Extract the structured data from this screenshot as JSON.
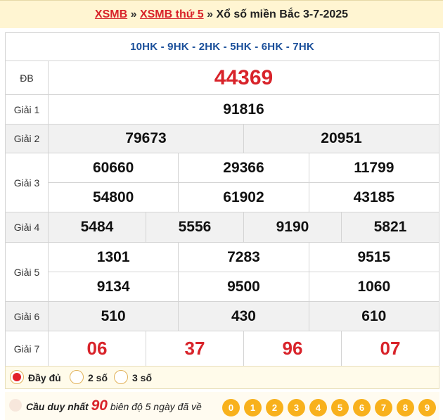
{
  "header": {
    "link1": "XSMB",
    "sep1": " » ",
    "link2": "XSMB thứ 5",
    "sep2": " » ",
    "title": "Xổ số miền Bắc 3-7-2025"
  },
  "codes": "10HK - 9HK - 2HK - 5HK - 6HK - 7HK",
  "prizes": {
    "db": {
      "label": "ĐB",
      "numbers": [
        "44369"
      ]
    },
    "g1": {
      "label": "Giải 1",
      "numbers": [
        "91816"
      ]
    },
    "g2": {
      "label": "Giải 2",
      "numbers": [
        "79673",
        "20951"
      ]
    },
    "g3": {
      "label": "Giải 3",
      "numbers": [
        "60660",
        "29366",
        "11799",
        "54800",
        "61902",
        "43185"
      ]
    },
    "g4": {
      "label": "Giải 4",
      "numbers": [
        "5484",
        "5556",
        "9190",
        "5821"
      ]
    },
    "g5": {
      "label": "Giải 5",
      "numbers": [
        "1301",
        "7283",
        "9515",
        "9134",
        "9500",
        "1060"
      ]
    },
    "g6": {
      "label": "Giải 6",
      "numbers": [
        "510",
        "430",
        "610"
      ]
    },
    "g7": {
      "label": "Giải 7",
      "numbers": [
        "06",
        "37",
        "96",
        "07"
      ]
    }
  },
  "options": [
    {
      "label": "Đầy đủ",
      "checked": true
    },
    {
      "label": "2 số",
      "checked": false
    },
    {
      "label": "3 số",
      "checked": false
    }
  ],
  "cau": {
    "prefix": "Cầu duy nhất",
    "value": "90",
    "suffix": "biên độ 5 ngày đã về"
  },
  "digits": [
    "0",
    "1",
    "2",
    "3",
    "4",
    "5",
    "6",
    "7",
    "8",
    "9"
  ],
  "colors": {
    "accent_red": "#d8232a",
    "code_blue": "#1a4f9a",
    "digit_orange": "#f8b11c",
    "header_bg": "#fff5d2"
  }
}
